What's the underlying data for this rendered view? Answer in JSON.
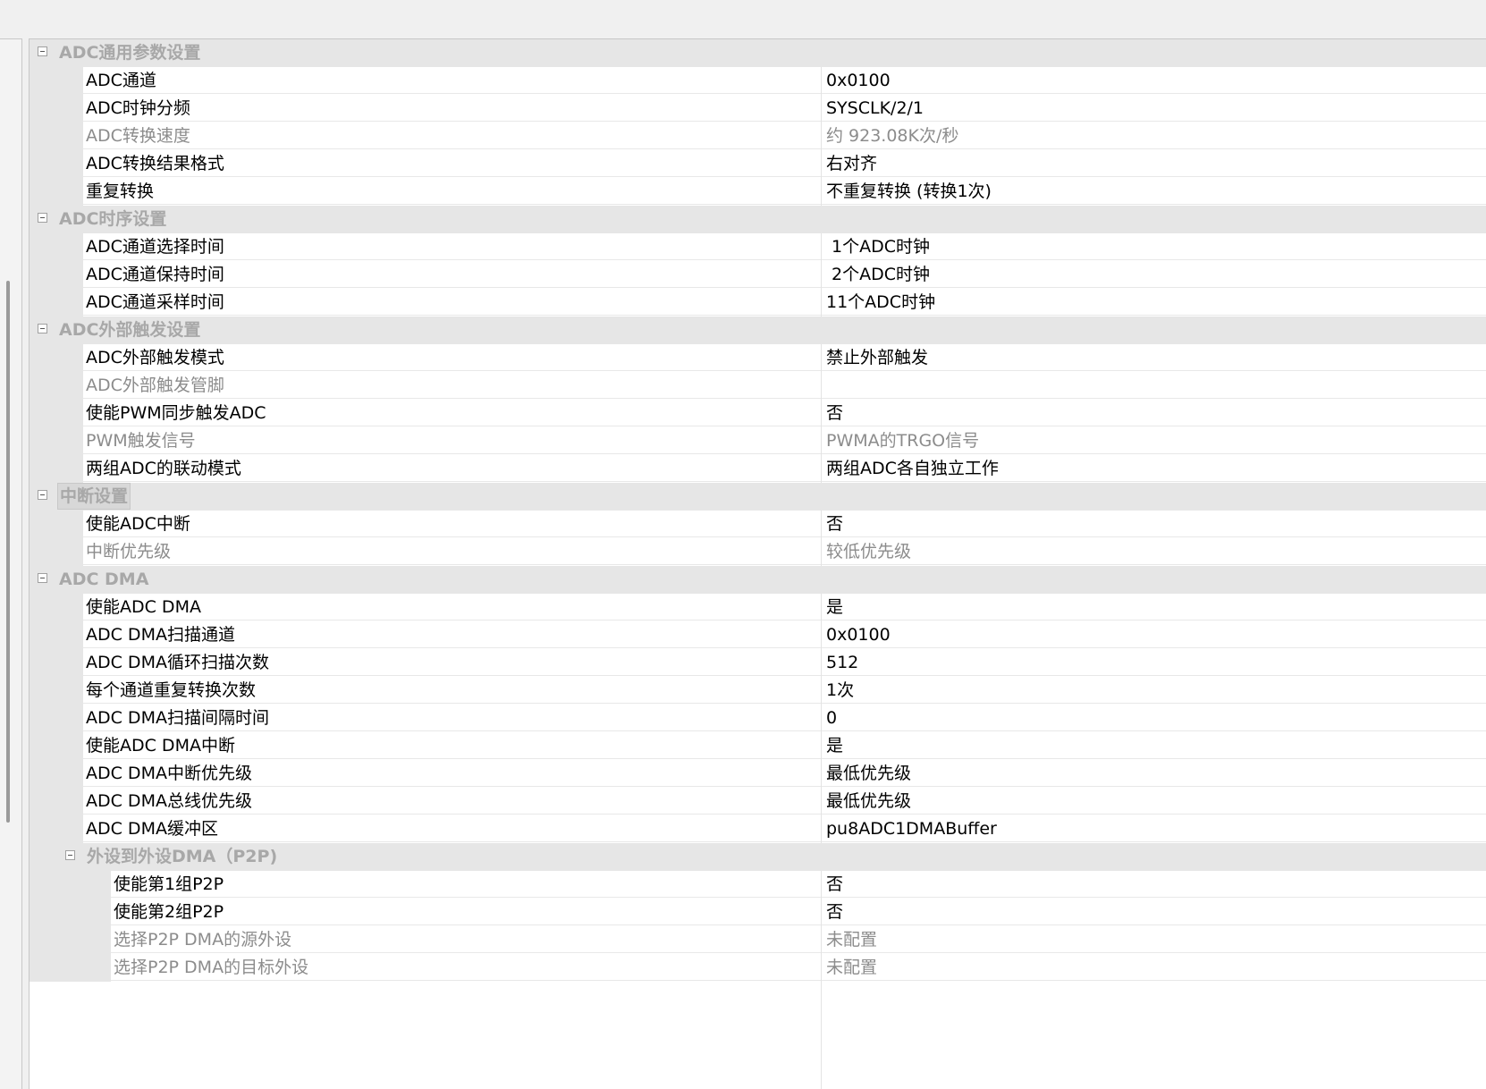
{
  "sections": [
    {
      "title": "ADC通用参数设置",
      "level": 1,
      "props": [
        {
          "name": "ADC通道",
          "value": "0x0100",
          "enabled": true
        },
        {
          "name": "ADC时钟分频",
          "value": "SYSCLK/2/1",
          "enabled": true
        },
        {
          "name": "ADC转换速度",
          "value": "约 923.08K次/秒",
          "enabled": false
        },
        {
          "name": "ADC转换结果格式",
          "value": "右对齐",
          "enabled": true
        },
        {
          "name": "重复转换",
          "value": "不重复转换 (转换1次)",
          "enabled": true
        }
      ]
    },
    {
      "title": "ADC时序设置",
      "level": 1,
      "props": [
        {
          "name": "ADC通道选择时间",
          "value": " 1个ADC时钟",
          "enabled": true
        },
        {
          "name": "ADC通道保持时间",
          "value": " 2个ADC时钟",
          "enabled": true
        },
        {
          "name": "ADC通道采样时间",
          "value": "11个ADC时钟",
          "enabled": true
        }
      ]
    },
    {
      "title": "ADC外部触发设置",
      "level": 1,
      "props": [
        {
          "name": "ADC外部触发模式",
          "value": "禁止外部触发",
          "enabled": true
        },
        {
          "name": "ADC外部触发管脚",
          "value": "",
          "enabled": false
        },
        {
          "name": "使能PWM同步触发ADC",
          "value": "否",
          "enabled": true
        },
        {
          "name": "PWM触发信号",
          "value": "PWMA的TRGO信号",
          "enabled": false
        },
        {
          "name": "两组ADC的联动模式",
          "value": "两组ADC各自独立工作",
          "enabled": true
        }
      ]
    },
    {
      "title": "中断设置",
      "level": 1,
      "focused": true,
      "props": [
        {
          "name": "使能ADC中断",
          "value": "否",
          "enabled": true
        },
        {
          "name": "中断优先级",
          "value": "较低优先级",
          "enabled": false
        }
      ]
    },
    {
      "title": "ADC DMA",
      "level": 1,
      "props": [
        {
          "name": "使能ADC DMA",
          "value": "是",
          "enabled": true
        },
        {
          "name": "ADC DMA扫描通道",
          "value": "0x0100",
          "enabled": true
        },
        {
          "name": "ADC DMA循环扫描次数",
          "value": "512",
          "enabled": true
        },
        {
          "name": "每个通道重复转换次数",
          "value": "1次",
          "enabled": true
        },
        {
          "name": "ADC DMA扫描间隔时间",
          "value": "0",
          "enabled": true
        },
        {
          "name": "使能ADC DMA中断",
          "value": "是",
          "enabled": true
        },
        {
          "name": "ADC DMA中断优先级",
          "value": "最低优先级",
          "enabled": true
        },
        {
          "name": "ADC DMA总线优先级",
          "value": "最低优先级",
          "enabled": true
        },
        {
          "name": "ADC DMA缓冲区",
          "value": "pu8ADC1DMABuffer",
          "enabled": true
        }
      ]
    },
    {
      "title": "外设到外设DMA（P2P)",
      "level": 2,
      "props": [
        {
          "name": "使能第1组P2P",
          "value": "否",
          "enabled": true
        },
        {
          "name": "使能第2组P2P",
          "value": "否",
          "enabled": true
        },
        {
          "name": "选择P2P DMA的源外设",
          "value": "未配置",
          "enabled": false
        },
        {
          "name": "选择P2P DMA的目标外设",
          "value": "未配置",
          "enabled": false
        }
      ]
    }
  ]
}
